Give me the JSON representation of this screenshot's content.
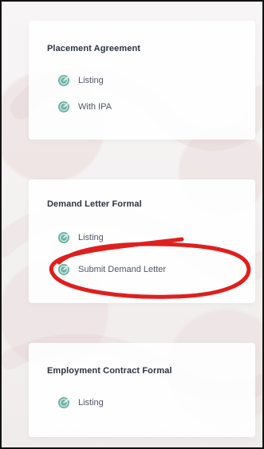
{
  "sections": [
    {
      "title": "Placement Agreement",
      "items": [
        {
          "label": "Listing"
        },
        {
          "label": "With IPA"
        }
      ]
    },
    {
      "title": "Demand Letter Formal",
      "items": [
        {
          "label": "Listing"
        },
        {
          "label": "Submit Demand Letter"
        }
      ]
    },
    {
      "title": "Employment Contract Formal",
      "items": [
        {
          "label": "Listing"
        }
      ]
    }
  ],
  "icons": {
    "item_icon": "radar-icon"
  },
  "colors": {
    "accent": "#5ea79a",
    "annotation": "#df1f1f",
    "title": "#2c3340",
    "text": "#4f5664"
  }
}
